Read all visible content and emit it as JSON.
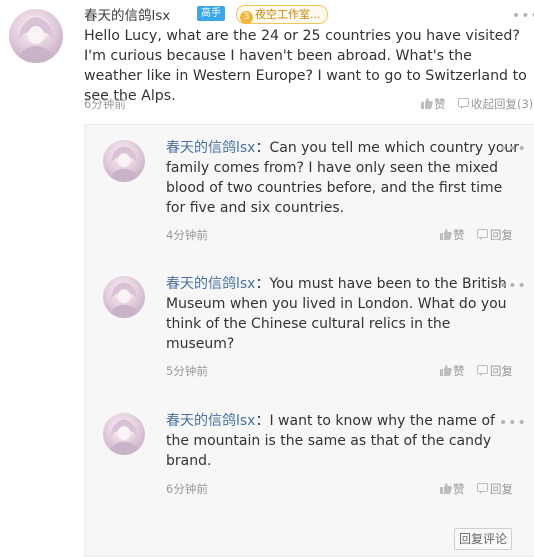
{
  "main_comment": {
    "username": "春天的信鸽lsx",
    "level_badge": "高手",
    "org_badge": "夜空工作室...",
    "org_icon": "3",
    "text": "Hello Lucy, what are the 24 or 25 countries you have visited? I'm curious because I haven't been abroad. What's the weather like in Western Europe? I want to go to Switzerland to see the Alps.",
    "time": "6分钟前",
    "like_label": "赞",
    "collapse_label": "收起回复(3)"
  },
  "replies": [
    {
      "username": "春天的信鸽lsx",
      "separator": "：",
      "text": "Can you tell me which country your family comes from? I have only seen the mixed blood of two countries before, and the first time for five and six countries.",
      "time": "4分钟前",
      "like_label": "赞",
      "reply_label": "回复"
    },
    {
      "username": "春天的信鸽lsx",
      "separator": "：",
      "text": "You must have been to the British Museum when you lived in London. What do you think of the Chinese cultural relics in the museum?",
      "time": "5分钟前",
      "like_label": "赞",
      "reply_label": "回复"
    },
    {
      "username": "春天的信鸽lsx",
      "separator": "：",
      "text": "I want to know why the name of the mountain is the same as that of the candy brand.",
      "time": "6分钟前",
      "like_label": "赞",
      "reply_label": "回复"
    }
  ],
  "reply_comment_button": "回复评论",
  "colors": {
    "level_badge_bg": "#3aa7e8",
    "reply_username": "#4a6fa3",
    "reply_box_bg": "#f7f7f7",
    "meta_text": "#999999"
  }
}
